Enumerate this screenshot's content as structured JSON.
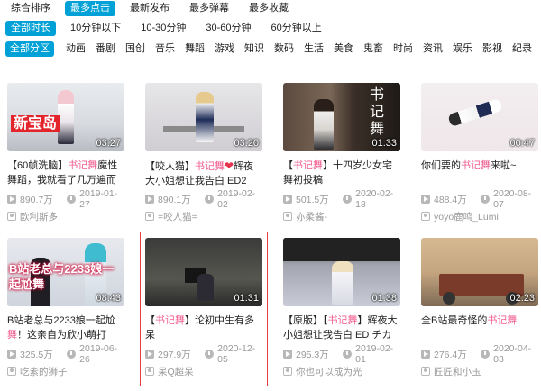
{
  "sort_tabs": [
    "综合排序",
    "最多点击",
    "最新发布",
    "最多弹幕",
    "最多收藏"
  ],
  "sort_active": 1,
  "duration_filters": [
    "全部时长",
    "10分钟以下",
    "10-30分钟",
    "30-60分钟",
    "60分钟以上"
  ],
  "duration_active": 0,
  "zone_filters": [
    "全部分区",
    "动画",
    "番剧",
    "国创",
    "音乐",
    "舞蹈",
    "游戏",
    "知识",
    "数码",
    "生活",
    "美食",
    "鬼畜",
    "时尚",
    "资讯",
    "娱乐",
    "影视",
    "纪录"
  ],
  "zone_active": 0,
  "colors": {
    "accent": "#00a1d6",
    "keyword": "#f25d8e",
    "highlight_border": "#e23c3c",
    "meta": "#999999"
  },
  "icons": {
    "views": "play-icon",
    "date": "clock-icon",
    "uploader": "uploader-icon",
    "like": "heart-icon"
  },
  "videos": [
    {
      "duration": "03:27",
      "title_pre": "【60帧洗脑】",
      "title_hl": "书记舞",
      "title_post": "魔性舞蹈，我就看了几万遍而已",
      "views": "890.7万",
      "date": "2019-01-27",
      "uploader": "欧利斯多",
      "overlay": "新宝岛"
    },
    {
      "duration": "03:20",
      "title_pre": "【咬人猫】",
      "title_hl": "书记舞",
      "title_post": "辉夜大小姐想让我告白 ED2",
      "heart": true,
      "views": "890.1万",
      "date": "2019-02-02",
      "uploader": "=咬人猫="
    },
    {
      "duration": "01:33",
      "title_pre": "【",
      "title_hl": "书记舞",
      "title_post": "】十四岁少女宅舞初投稿",
      "views": "501.5万",
      "date": "2020-02-18",
      "uploader": "亦柔酱-",
      "overlay": "书记舞"
    },
    {
      "duration": "00:47",
      "title_pre": "你们要的",
      "title_hl": "书记舞",
      "title_post": "来啦~",
      "views": "488.4万",
      "date": "2020-08-07",
      "uploader": "yoyo鹿鸣_Lumi"
    },
    {
      "duration": "08:43",
      "title_pre": "B站老总与2233娘一起尬",
      "title_hl": "舞",
      "title_post": "！这亲自为欣小萌打",
      "views": "325.5万",
      "date": "2019-06-26",
      "uploader": "吃素的狮子",
      "overlay": "B站老总与2233娘一起尬舞"
    },
    {
      "duration": "01:31",
      "title_pre": "【",
      "title_hl": "书记舞",
      "title_post": "】论初中生有多呆",
      "views": "297.9万",
      "date": "2020-12-05",
      "uploader": "呆Q超呆",
      "highlight": true
    },
    {
      "duration": "01:38",
      "title_pre": "【原版】【",
      "title_hl": "书记舞",
      "title_post": "】辉夜大小姐想让我告白 ED チカっ",
      "views": "295.3万",
      "date": "2019-02-01",
      "uploader": "你也可以成为光"
    },
    {
      "duration": "02:23",
      "title_pre": "全B站最奇怪的",
      "title_hl": "书记舞",
      "title_post": "",
      "views": "276.4万",
      "date": "2020-04-03",
      "uploader": "匠匠和小玉"
    }
  ]
}
